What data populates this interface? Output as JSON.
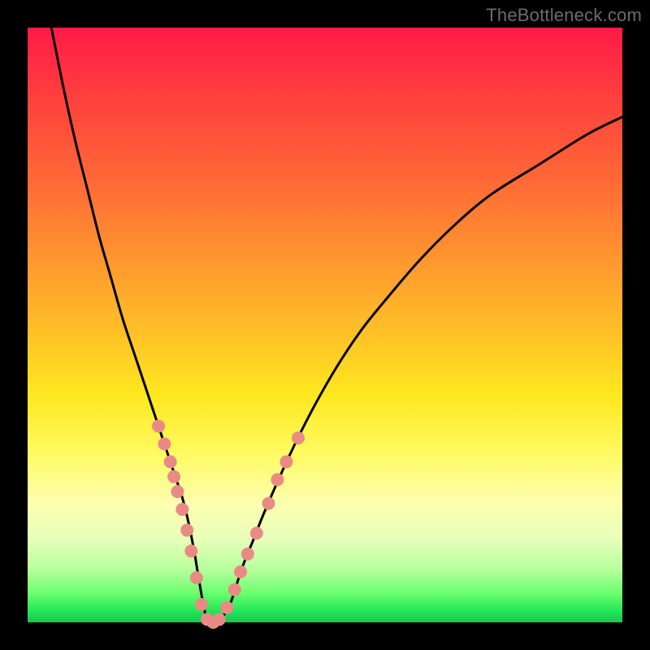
{
  "watermark": "TheBottleneck.com",
  "chart_data": {
    "type": "line",
    "title": "",
    "xlabel": "",
    "ylabel": "",
    "xlim": [
      0,
      100
    ],
    "ylim": [
      0,
      100
    ],
    "background": "red-to-green vertical gradient",
    "series": [
      {
        "name": "bottleneck-curve",
        "stroke": "#000000",
        "x": [
          4,
          6,
          8,
          10,
          12,
          14,
          16,
          18,
          20,
          22,
          24,
          25,
          26,
          27,
          28,
          29,
          30,
          31,
          32,
          34,
          36,
          38,
          40,
          44,
          48,
          52,
          56,
          60,
          66,
          72,
          78,
          86,
          94,
          100
        ],
        "y": [
          100,
          90,
          81,
          73,
          65,
          58,
          51,
          45,
          39,
          33,
          27,
          24,
          21,
          17,
          12,
          6,
          1,
          0,
          0,
          3,
          9,
          14,
          19,
          28,
          36,
          43,
          49,
          54,
          61,
          67,
          72,
          77,
          82,
          85
        ]
      }
    ],
    "markers": {
      "name": "highlighted-points",
      "color": "#e98b84",
      "radius_px": 8,
      "points": [
        {
          "x": 22,
          "y": 33
        },
        {
          "x": 23,
          "y": 30
        },
        {
          "x": 24,
          "y": 27
        },
        {
          "x": 24.6,
          "y": 24.5
        },
        {
          "x": 25.2,
          "y": 22
        },
        {
          "x": 26,
          "y": 19
        },
        {
          "x": 26.8,
          "y": 15.5
        },
        {
          "x": 27.5,
          "y": 12
        },
        {
          "x": 28.4,
          "y": 7.5
        },
        {
          "x": 29.2,
          "y": 3
        },
        {
          "x": 30.2,
          "y": 0.5
        },
        {
          "x": 31.2,
          "y": 0
        },
        {
          "x": 32.2,
          "y": 0.5
        },
        {
          "x": 33.5,
          "y": 2.5
        },
        {
          "x": 34.8,
          "y": 5.5
        },
        {
          "x": 35.8,
          "y": 8.5
        },
        {
          "x": 37,
          "y": 11.5
        },
        {
          "x": 38.5,
          "y": 15
        },
        {
          "x": 40.5,
          "y": 20
        },
        {
          "x": 42,
          "y": 24
        },
        {
          "x": 43.5,
          "y": 27
        },
        {
          "x": 45.5,
          "y": 31
        }
      ]
    }
  }
}
